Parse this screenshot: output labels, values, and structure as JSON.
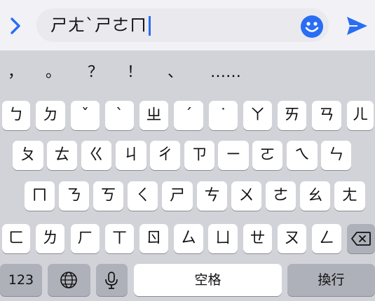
{
  "input": {
    "text": "ㄕㄤˋㄕㄜㄇ"
  },
  "icons": {
    "back": "chevron-right-icon",
    "emoji": "smiley-face-icon",
    "send": "paper-plane-send-icon",
    "delete": "backspace-icon",
    "globe": "globe-icon",
    "mic": "microphone-icon"
  },
  "candidates": [
    "，",
    "。",
    "？",
    "！",
    "、",
    "……"
  ],
  "rows": [
    [
      "ㄅ",
      "ㄉ",
      "ˇ",
      "ˋ",
      "ㄓ",
      "ˊ",
      "˙",
      "ㄚ",
      "ㄞ",
      "ㄢ",
      "ㄦ"
    ],
    [
      "ㄆ",
      "ㄊ",
      "ㄍ",
      "ㄐ",
      "ㄔ",
      "ㄗ",
      "ㄧ",
      "ㄛ",
      "ㄟ",
      "ㄣ"
    ],
    [
      "ㄇ",
      "ㄋ",
      "ㄎ",
      "ㄑ",
      "ㄕ",
      "ㄘ",
      "ㄨ",
      "ㄜ",
      "ㄠ",
      "ㄤ"
    ],
    [
      "ㄈ",
      "ㄌ",
      "ㄏ",
      "ㄒ",
      "ㄖ",
      "ㄙ",
      "ㄩ",
      "ㄝ",
      "ㄡ",
      "ㄥ"
    ]
  ],
  "bottom": {
    "numbers": "123",
    "space": "空格",
    "return": "換行"
  },
  "colors": {
    "accent": "#2a6df4",
    "key": "#ffffff",
    "dark_key": "#aeb1ba",
    "keyboard_bg": "#d1d3d9"
  }
}
